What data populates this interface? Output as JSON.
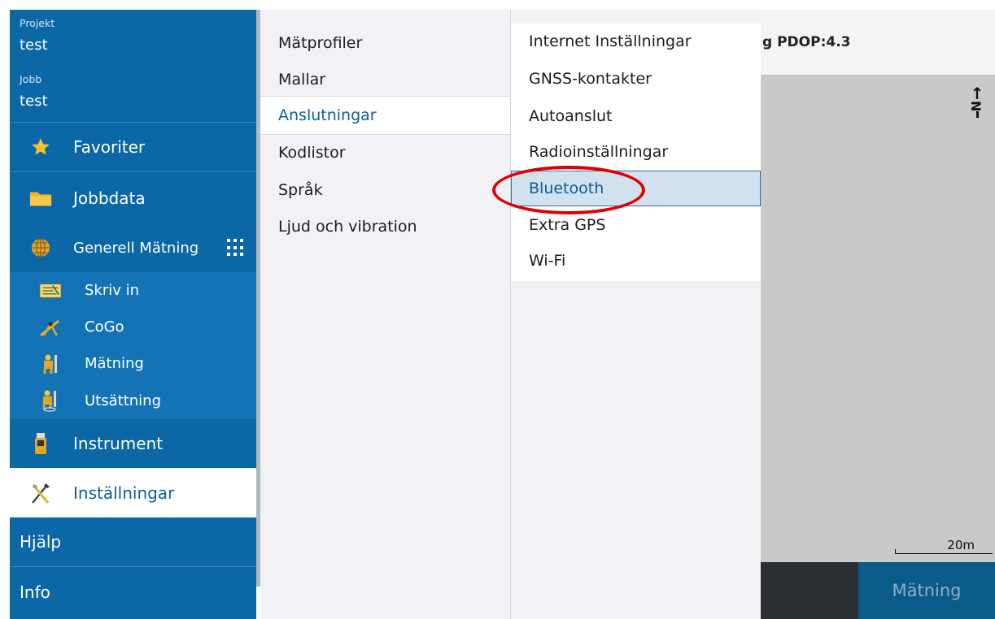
{
  "map": {
    "status_text": "g PDOP:4.3",
    "north_label": "N",
    "scale_label": "20m",
    "action_button": "Mätning"
  },
  "sidebar": {
    "project_label": "Projekt",
    "project_value": "test",
    "job_label": "Jobb",
    "job_value": "test",
    "items": [
      {
        "label": "Favoriter",
        "icon": "star-icon"
      },
      {
        "label": "Jobbdata",
        "icon": "folder-icon"
      },
      {
        "label": "Generell Mätning",
        "icon": "globe-icon"
      },
      {
        "label": "Skriv in",
        "icon": "keyin-icon"
      },
      {
        "label": "CoGo",
        "icon": "cogo-icon"
      },
      {
        "label": "Mätning",
        "icon": "surveyor-icon"
      },
      {
        "label": "Utsättning",
        "icon": "stakeout-icon"
      },
      {
        "label": "Instrument",
        "icon": "instrument-icon"
      },
      {
        "label": "Inställningar",
        "icon": "tools-icon"
      },
      {
        "label": "Hjälp"
      },
      {
        "label": "Info"
      }
    ]
  },
  "settings_menu": {
    "items": [
      "Mätprofiler",
      "Mallar",
      "Anslutningar",
      "Kodlistor",
      "Språk",
      "Ljud och vibration"
    ],
    "active": "Anslutningar"
  },
  "connections_menu": {
    "items": [
      "Internet Inställningar",
      "GNSS-kontakter",
      "Autoanslut",
      "Radioinställningar",
      "Bluetooth",
      "Extra GPS",
      "Wi-Fi"
    ],
    "selected": "Bluetooth"
  },
  "colors": {
    "sidebar": "#0b67a6",
    "accent_text": "#0b5e98",
    "highlight": "#e00000",
    "selection": "#d2e1ee"
  }
}
